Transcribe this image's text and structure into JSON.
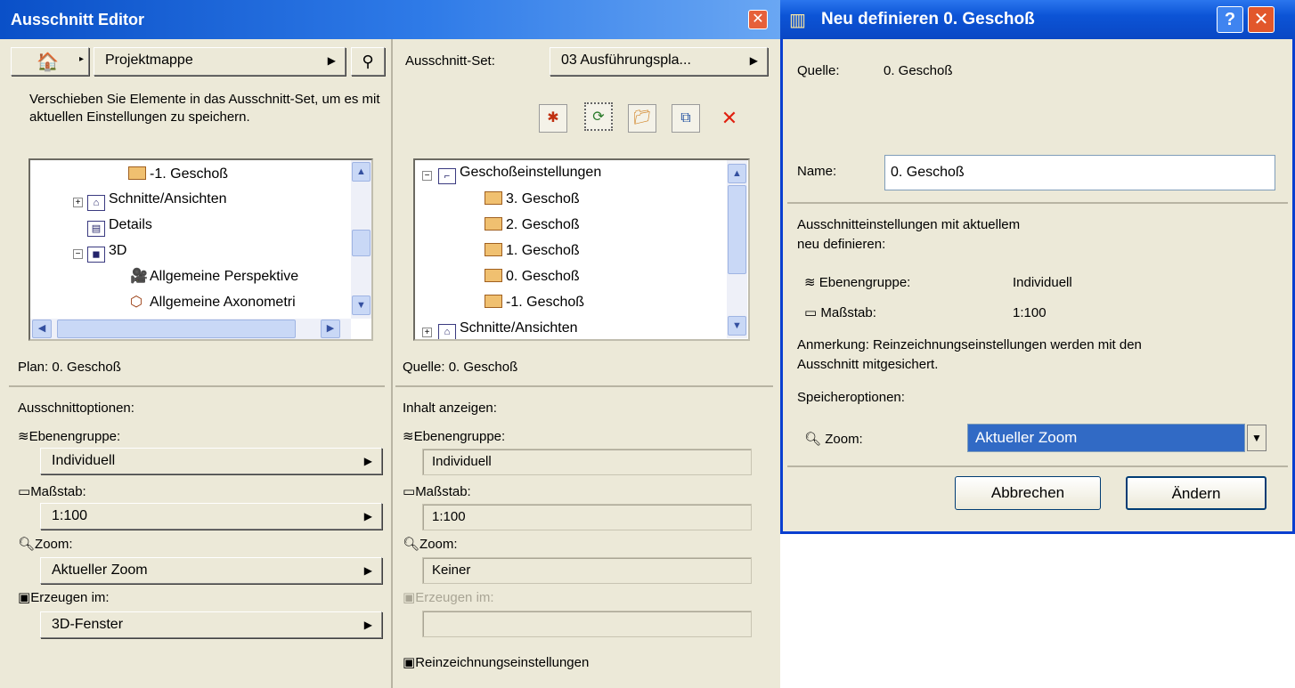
{
  "editor": {
    "title": "Ausschnitt Editor",
    "left": {
      "source_label": "Projektmappe",
      "hint": "Verschieben Sie Elemente in das Ausschnitt-Set, um es mit aktuellen Einstellungen zu speichern.",
      "tree": [
        {
          "label": "-1. Geschoß",
          "icon": "floor-icon"
        },
        {
          "label": "Schnitte/Ansichten",
          "icon": "section-icon",
          "expander": "+"
        },
        {
          "label": "Details",
          "icon": "detail-icon"
        },
        {
          "label": "3D",
          "icon": "3d-icon",
          "expander": "−"
        },
        {
          "label": "Allgemeine Perspektive",
          "icon": "camera-icon"
        },
        {
          "label": "Allgemeine Axonometri",
          "icon": "axonometry-icon"
        }
      ],
      "plan_text": "Plan: 0. Geschoß",
      "options_heading": "Ausschnittoptionen:",
      "layer_label": "Ebenengruppe:",
      "layer_value": "Individuell",
      "scale_label": "Maßstab:",
      "scale_value": "1:100",
      "zoom_label": "Zoom:",
      "zoom_value": "Aktueller Zoom",
      "create_label": "Erzeugen im:",
      "create_value": "3D-Fenster"
    },
    "right": {
      "set_label": "Ausschnitt-Set:",
      "set_value": "03 Ausführungspla...",
      "tree": [
        {
          "label": "Geschoßeinstellungen",
          "icon": "floor-settings-icon",
          "expander": "−"
        },
        {
          "label": "3. Geschoß",
          "icon": "floor-icon"
        },
        {
          "label": "2. Geschoß",
          "icon": "floor-icon"
        },
        {
          "label": "1. Geschoß",
          "icon": "floor-icon"
        },
        {
          "label": "0. Geschoß",
          "icon": "floor-icon"
        },
        {
          "label": "-1. Geschoß",
          "icon": "floor-icon"
        },
        {
          "label": "Schnitte/Ansichten",
          "icon": "section-icon",
          "expander": "+"
        }
      ],
      "source_text": "Quelle: 0. Geschoß",
      "content_heading": "Inhalt anzeigen:",
      "layer_label": "Ebenengruppe:",
      "layer_value": "Individuell",
      "scale_label": "Maßstab:",
      "scale_value": "1:100",
      "zoom_label": "Zoom:",
      "zoom_value": "Keiner",
      "create_label": "Erzeugen im:",
      "create_value": "",
      "model_label": "Reinzeichnungseinstellungen"
    }
  },
  "dialog": {
    "title": "Neu definieren 0. Geschoß",
    "source_label": "Quelle:",
    "source_value": "0. Geschoß",
    "name_label": "Name:",
    "name_value": "0. Geschoß",
    "redefine_text_1": "Ausschnitteinstellungen mit aktuellem",
    "redefine_text_2": "neu definieren:",
    "layer_label": "Ebenengruppe:",
    "layer_value": "Individuell",
    "scale_label": "Maßstab:",
    "scale_value": "1:100",
    "note_1": "Anmerkung: Reinzeichnungseinstellungen werden mit den",
    "note_2": "Ausschnitt mitgesichert.",
    "save_options": "Speicheroptionen:",
    "zoom_label": "Zoom:",
    "zoom_value": "Aktueller Zoom",
    "cancel": "Abbrechen",
    "ok": "Ändern",
    "help": "?"
  }
}
